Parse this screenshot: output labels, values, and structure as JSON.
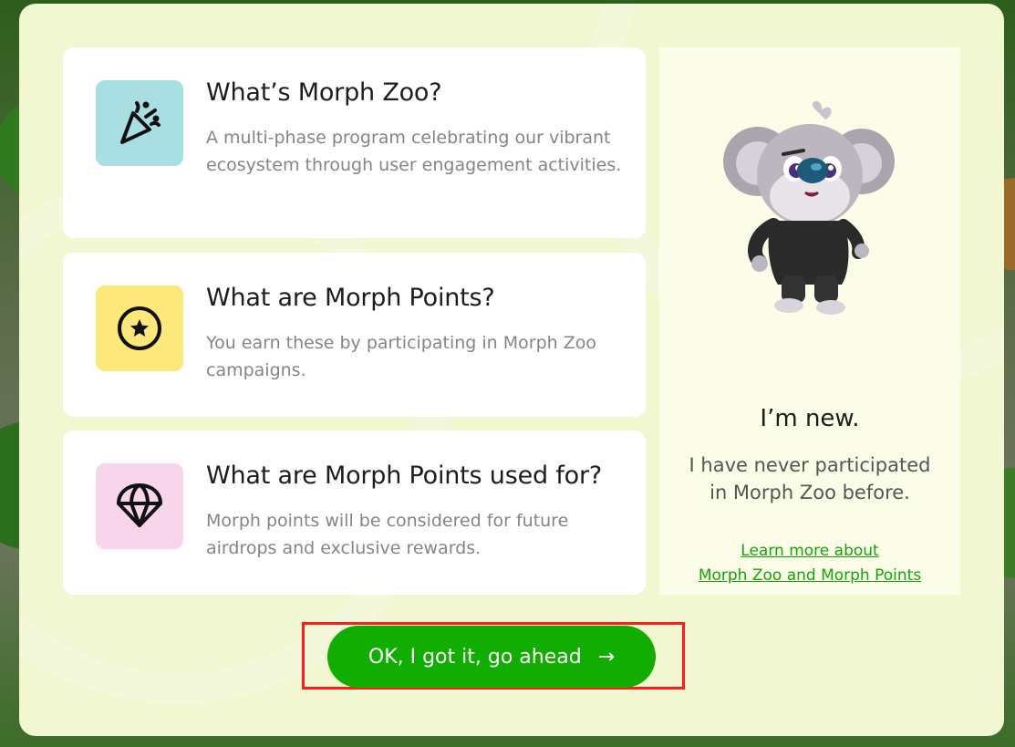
{
  "cards": [
    {
      "title": "What’s Morph Zoo?",
      "description": "A multi-phase program celebrating our vibrant ecosystem through user engagement activities.",
      "icon": "party-popper-icon",
      "icon_bg": "#a9dfe2"
    },
    {
      "title": "What are Morph Points?",
      "description": "You earn these by participating in Morph Zoo campaigns.",
      "icon": "star-coin-icon",
      "icon_bg": "#fbe77a"
    },
    {
      "title": "What are Morph Points used for?",
      "description": "Morph points will be considered for future airdrops and exclusive rewards.",
      "icon": "parachute-icon",
      "icon_bg": "#f9d5ec"
    }
  ],
  "side_panel": {
    "mascot": "koala-mascot",
    "headline": "I’m new.",
    "subtext": "I have never participated in Morph Zoo before.",
    "link_line1": "Learn more about",
    "link_line2": "Morph Zoo and Morph Points"
  },
  "cta": {
    "label": "OK, I got it, go ahead",
    "arrow": "→"
  },
  "colors": {
    "accent": "#11ad00",
    "modal_bg": "#f0f7d1",
    "highlight_border": "#ff1c1c"
  }
}
